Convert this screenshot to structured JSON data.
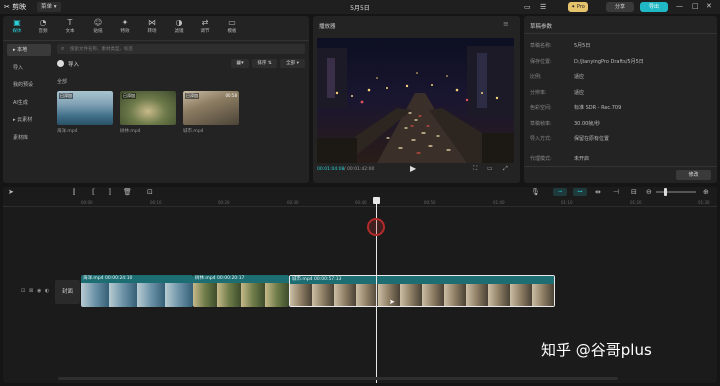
{
  "titlebar": {
    "logo": "✂ 剪映",
    "menu": "菜单 ▾",
    "title": "5月5日",
    "btn_pro": "✦ Pro",
    "btn_share": "分享",
    "btn_export": "导出"
  },
  "media": {
    "tools": [
      {
        "icon": "▣",
        "label": "媒体"
      },
      {
        "icon": "◔",
        "label": "音频"
      },
      {
        "icon": "T",
        "label": "文本"
      },
      {
        "icon": "☺",
        "label": "贴纸"
      },
      {
        "icon": "✦",
        "label": "特效"
      },
      {
        "icon": "⋈",
        "label": "转场"
      },
      {
        "icon": "◑",
        "label": "滤镜"
      },
      {
        "icon": "⇄",
        "label": "调节"
      },
      {
        "icon": "▭",
        "label": "模板"
      }
    ],
    "side": [
      "▸ 本地",
      "导入",
      "我的预设",
      "AI生成",
      "▸ 云素材",
      "素材库"
    ],
    "search_placeholder": "搜索文件名称、素材类型、标签",
    "import_label": "导入",
    "sort_label": "排序",
    "all_label": "全部",
    "section": "全部",
    "clips": [
      {
        "tag": "已添加",
        "dur": "",
        "name": "海洋.mp4"
      },
      {
        "tag": "已添加",
        "dur": "",
        "name": "树林.mp4"
      },
      {
        "tag": "已添加",
        "dur": "00:58",
        "name": "城市.mp4"
      }
    ]
  },
  "player": {
    "title": "播放器",
    "time_current": "00:01:04:08",
    "time_total": "00:01:42:00"
  },
  "props": {
    "title": "草稿参数",
    "rows": [
      {
        "k": "草稿名称:",
        "v": "5月5日"
      },
      {
        "k": "保存位置:",
        "v": "D:/JianyingPro Drafts/5月5日"
      },
      {
        "k": "比例:",
        "v": "适应"
      },
      {
        "k": "分辨率:",
        "v": "适应"
      },
      {
        "k": "色彩空间:",
        "v": "标准 SDR - Rec.709"
      },
      {
        "k": "草稿帧率:",
        "v": "30.00帧/秒"
      },
      {
        "k": "导入方式:",
        "v": "保留在原有位置"
      },
      {
        "k": "代理模式:",
        "v": "未开启"
      }
    ],
    "edit_label": "修改"
  },
  "timeline": {
    "ticks": [
      "00:00",
      "00:10",
      "00:20",
      "00:30",
      "00:40",
      "00:50",
      "01:00",
      "01:10",
      "01:20",
      "01:30"
    ],
    "cover_label": "封面",
    "clips": [
      {
        "title": "海洋.mp4  00:00:24:10"
      },
      {
        "title": "树林.mp4  00:00:20:17"
      },
      {
        "title": "城市.mp4  00:00:57:13"
      }
    ]
  },
  "watermark": "知乎 @谷哥plus"
}
